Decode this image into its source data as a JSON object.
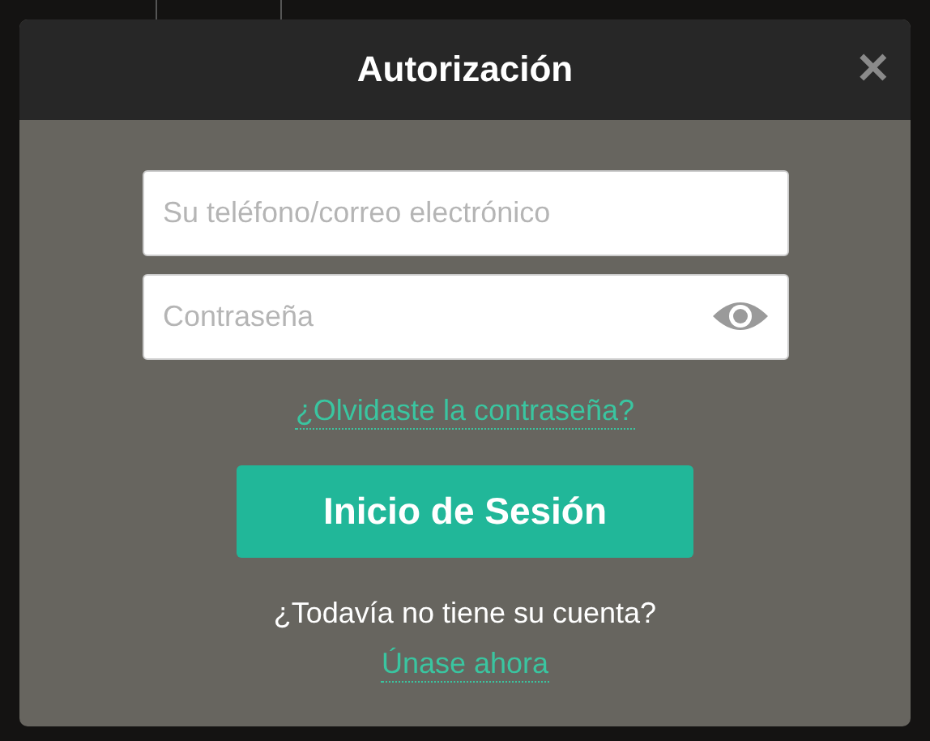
{
  "dialog": {
    "title": "Autorización",
    "close": "✕",
    "fields": [
      {
        "kind": "text",
        "placeholder": "Su teléfono/correo electrónico"
      },
      {
        "kind": "password",
        "placeholder": "Contraseña"
      }
    ],
    "forgot_link": "¿Olvidaste la contraseña?",
    "submit": "Inicio de Sesión",
    "signup_prompt": "¿Todavía no tiene su cuenta?",
    "signup_link": "Únase ahora"
  }
}
